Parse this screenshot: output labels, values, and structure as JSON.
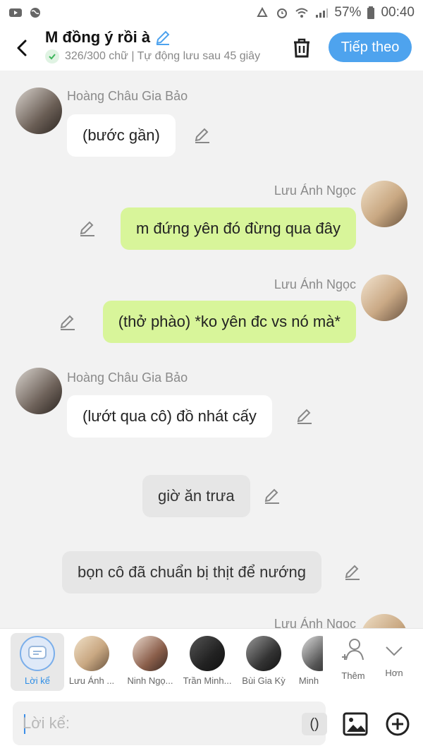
{
  "status": {
    "battery": "57%",
    "time": "00:40"
  },
  "header": {
    "title": "M đồng ý rồi à",
    "subtitle": "326/300 chữ | Tự động lưu sau 45 giây",
    "next_label": "Tiếp theo"
  },
  "messages": [
    {
      "sender": "Hoàng Châu Gia Bảo",
      "text": "(bước gần)"
    },
    {
      "sender": "Lưu Ánh Ngọc",
      "text": "m đứng yên đó đừng qua đây"
    },
    {
      "sender": "Lưu Ánh Ngọc",
      "text": "(thở phào) *ko yên đc vs nó mà*"
    },
    {
      "sender": "Hoàng Châu Gia Bảo",
      "text": "(lướt qua cô) đồ nhát cấy"
    },
    {
      "text": "giờ ăn trưa"
    },
    {
      "text": "bọn cô đã chuẩn bị thịt để nướng"
    },
    {
      "sender": "Lưu Ánh Ngọc"
    }
  ],
  "characters": [
    {
      "name": "Lời kể"
    },
    {
      "name": "Lưu Ánh ..."
    },
    {
      "name": "Ninh Ngọ..."
    },
    {
      "name": "Trần Minh..."
    },
    {
      "name": "Bùi Gia Kỳ"
    },
    {
      "name": "Minh"
    },
    {
      "name": "Thêm"
    },
    {
      "name": "Hơn"
    }
  ],
  "input": {
    "placeholder": "Lời kể:",
    "paren_label": "()"
  },
  "colors": {
    "accent": "#4ea3ee",
    "user_bubble": "#d8f59a",
    "narration_bubble": "#e6e6e6"
  }
}
